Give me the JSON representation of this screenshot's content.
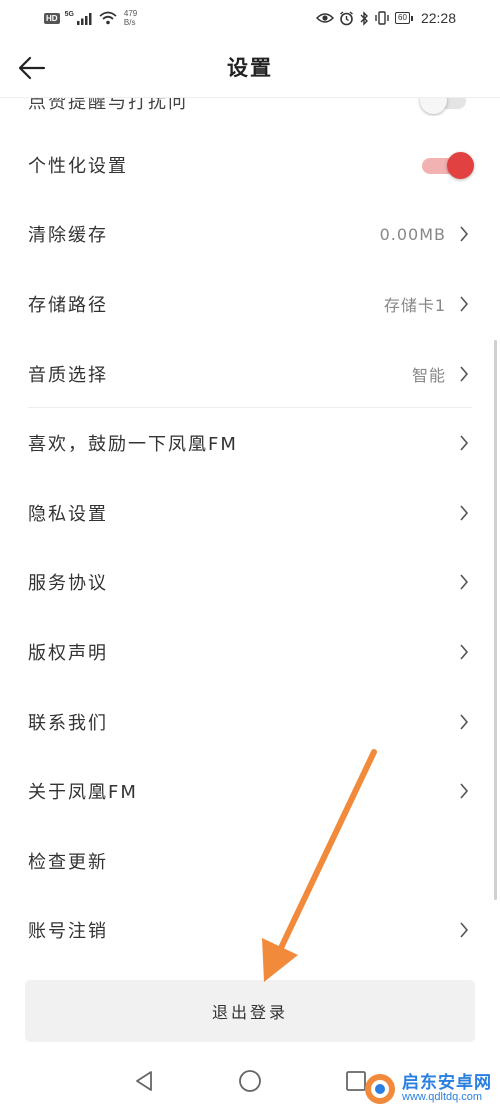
{
  "status_bar": {
    "hd_badge": "HD",
    "network_type": "5G",
    "speed_value": "479",
    "speed_unit": "B/s",
    "battery": "60",
    "time": "22:28"
  },
  "header": {
    "title": "设置",
    "back_icon": "back-arrow-icon"
  },
  "settings": {
    "cut_item": {
      "label": "点赞提醒与打扰问",
      "toggle_on": false
    },
    "personalization": {
      "label": "个性化设置",
      "toggle_on": true
    },
    "items": [
      {
        "label": "清除缓存",
        "value": "0.00MB",
        "chevron": true
      },
      {
        "label": "存储路径",
        "value": "存储卡1",
        "chevron": true
      },
      {
        "label": "音质选择",
        "value": "智能",
        "chevron": true
      },
      {
        "label": "喜欢，鼓励一下凤凰FM",
        "value": "",
        "chevron": true
      },
      {
        "label": "隐私设置",
        "value": "",
        "chevron": true
      },
      {
        "label": "服务协议",
        "value": "",
        "chevron": true
      },
      {
        "label": "版权声明",
        "value": "",
        "chevron": true
      },
      {
        "label": "联系我们",
        "value": "",
        "chevron": true
      },
      {
        "label": "关于凤凰FM",
        "value": "",
        "chevron": true
      },
      {
        "label": "检查更新",
        "value": "",
        "chevron": false
      },
      {
        "label": "账号注销",
        "value": "",
        "chevron": true
      }
    ]
  },
  "logout_button": "退出登录",
  "colors": {
    "toggle_on": "#e24141",
    "annotation_arrow": "#f28a3c",
    "watermark": "#2a7fe0"
  },
  "watermark": {
    "name": "启东安卓网",
    "url": "www.qdltdq.com"
  }
}
